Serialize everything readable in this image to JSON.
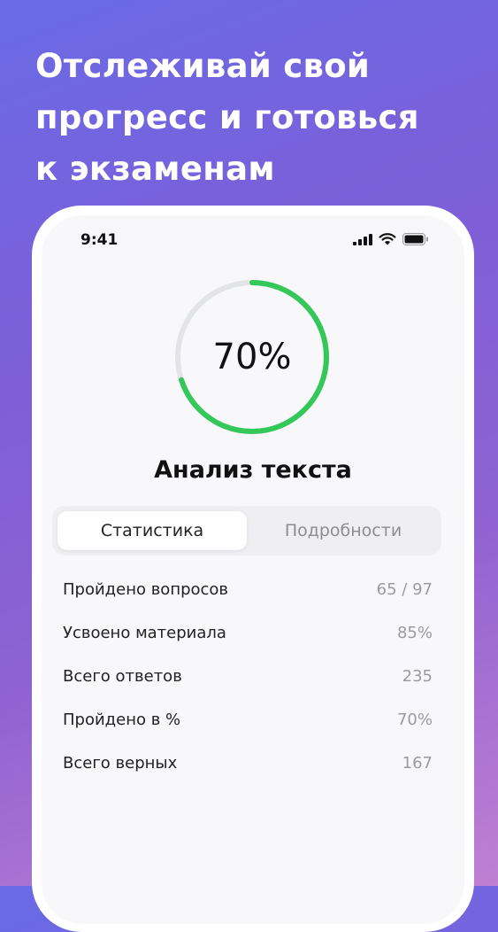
{
  "headline": {
    "lines": [
      "Отслеживай свой",
      "прогресс и готовься",
      "к экзаменам"
    ]
  },
  "status_bar": {
    "time": "9:41",
    "icons": [
      "signal-icon",
      "wifi-icon",
      "battery-icon"
    ]
  },
  "progress": {
    "percent_label": "70%",
    "fraction": 0.7,
    "colors": {
      "fill": "#34c759",
      "track": "#e3e4e8"
    }
  },
  "topic": {
    "title": "Анализ текста"
  },
  "tabs": [
    {
      "label": "Статистика",
      "active": true
    },
    {
      "label": "Подробности",
      "active": false
    }
  ],
  "stats": [
    {
      "label": "Пройдено вопросов",
      "value": "65 / 97"
    },
    {
      "label": "Усвоено материала",
      "value": "85%"
    },
    {
      "label": "Всего ответов",
      "value": "235"
    },
    {
      "label": "Пройдено в %",
      "value": "70%"
    },
    {
      "label": "Всего верных",
      "value": "167"
    }
  ]
}
